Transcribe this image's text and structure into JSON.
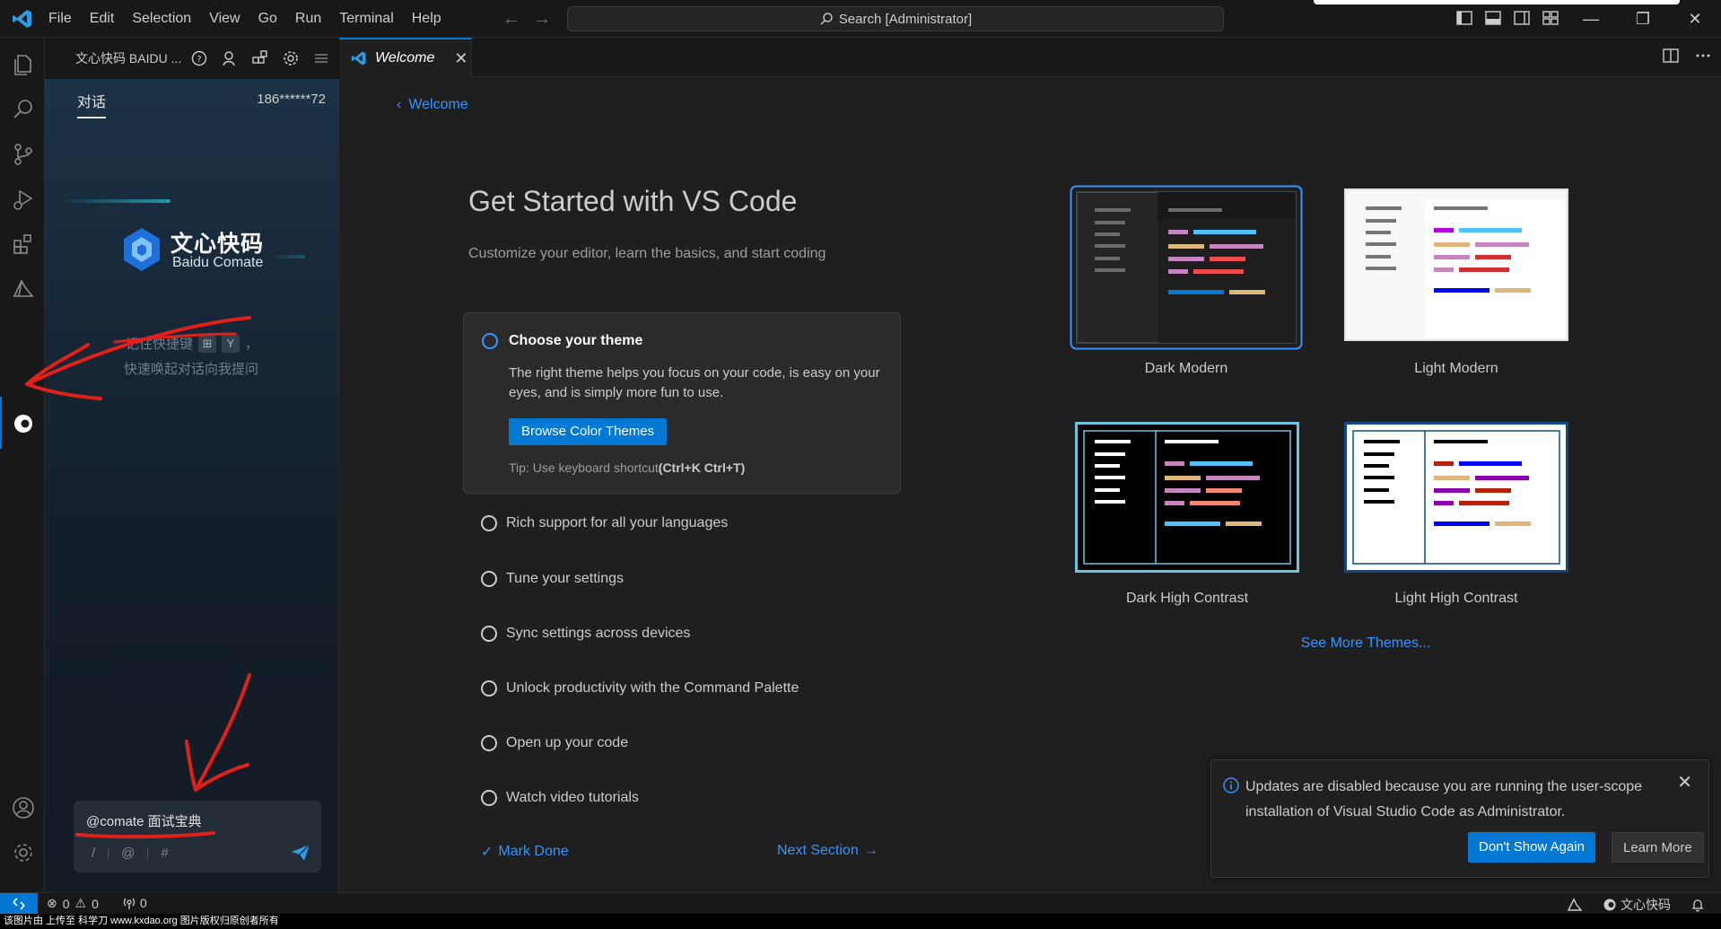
{
  "titlebar": {
    "menus": [
      "File",
      "Edit",
      "Selection",
      "View",
      "Go",
      "Run",
      "Terminal",
      "Help"
    ],
    "search": "Search [Administrator]"
  },
  "sidebar": {
    "title": "文心快码 BAIDU ...",
    "tab": "对话",
    "phone": "186******72",
    "logo_cn": "文心快码",
    "logo_en": "Baidu Comate",
    "tip_prefix": "记住快捷键",
    "tip_key": "Y",
    "tip_suffix": "，",
    "tip_line2": "快速唤起对话向我提问",
    "chat_input_value": "@comate 面试宝典",
    "chat_tools": [
      "/",
      "@",
      "#"
    ]
  },
  "editor": {
    "tab_label": "Welcome",
    "back_label": "Welcome",
    "title": "Get Started with VS Code",
    "subtitle": "Customize your editor, learn the basics, and start coding",
    "active_step": {
      "title": "Choose your theme",
      "description": "The right theme helps you focus on your code, is easy on your eyes, and is simply more fun to use.",
      "button": "Browse Color Themes",
      "tip_prefix": "Tip: Use keyboard shortcut",
      "tip_shortcut": "(Ctrl+K Ctrl+T)"
    },
    "steps": [
      "Rich support for all your languages",
      "Tune your settings",
      "Sync settings across devices",
      "Unlock productivity with the Command Palette",
      "Open up your code",
      "Watch video tutorials"
    ],
    "mark_done": "Mark Done",
    "next_section": "Next Section",
    "themes": [
      "Dark Modern",
      "Light Modern",
      "Dark High Contrast",
      "Light High Contrast"
    ],
    "see_more": "See More Themes..."
  },
  "notification": {
    "message": "Updates are disabled because you are running the user-scope installation of Visual Studio Code as Administrator.",
    "primary": "Don't Show Again",
    "secondary": "Learn More"
  },
  "statusbar": {
    "errors": "0",
    "warnings": "0",
    "ports": "0",
    "comate_label": "文心快码"
  },
  "watermark": "该图片由  上传至  科学刀  www.kxdao.org  图片版权归原创者所有",
  "colors": {
    "accent": "#0078d4",
    "link": "#3794ff",
    "annotation": "#e0201a"
  }
}
